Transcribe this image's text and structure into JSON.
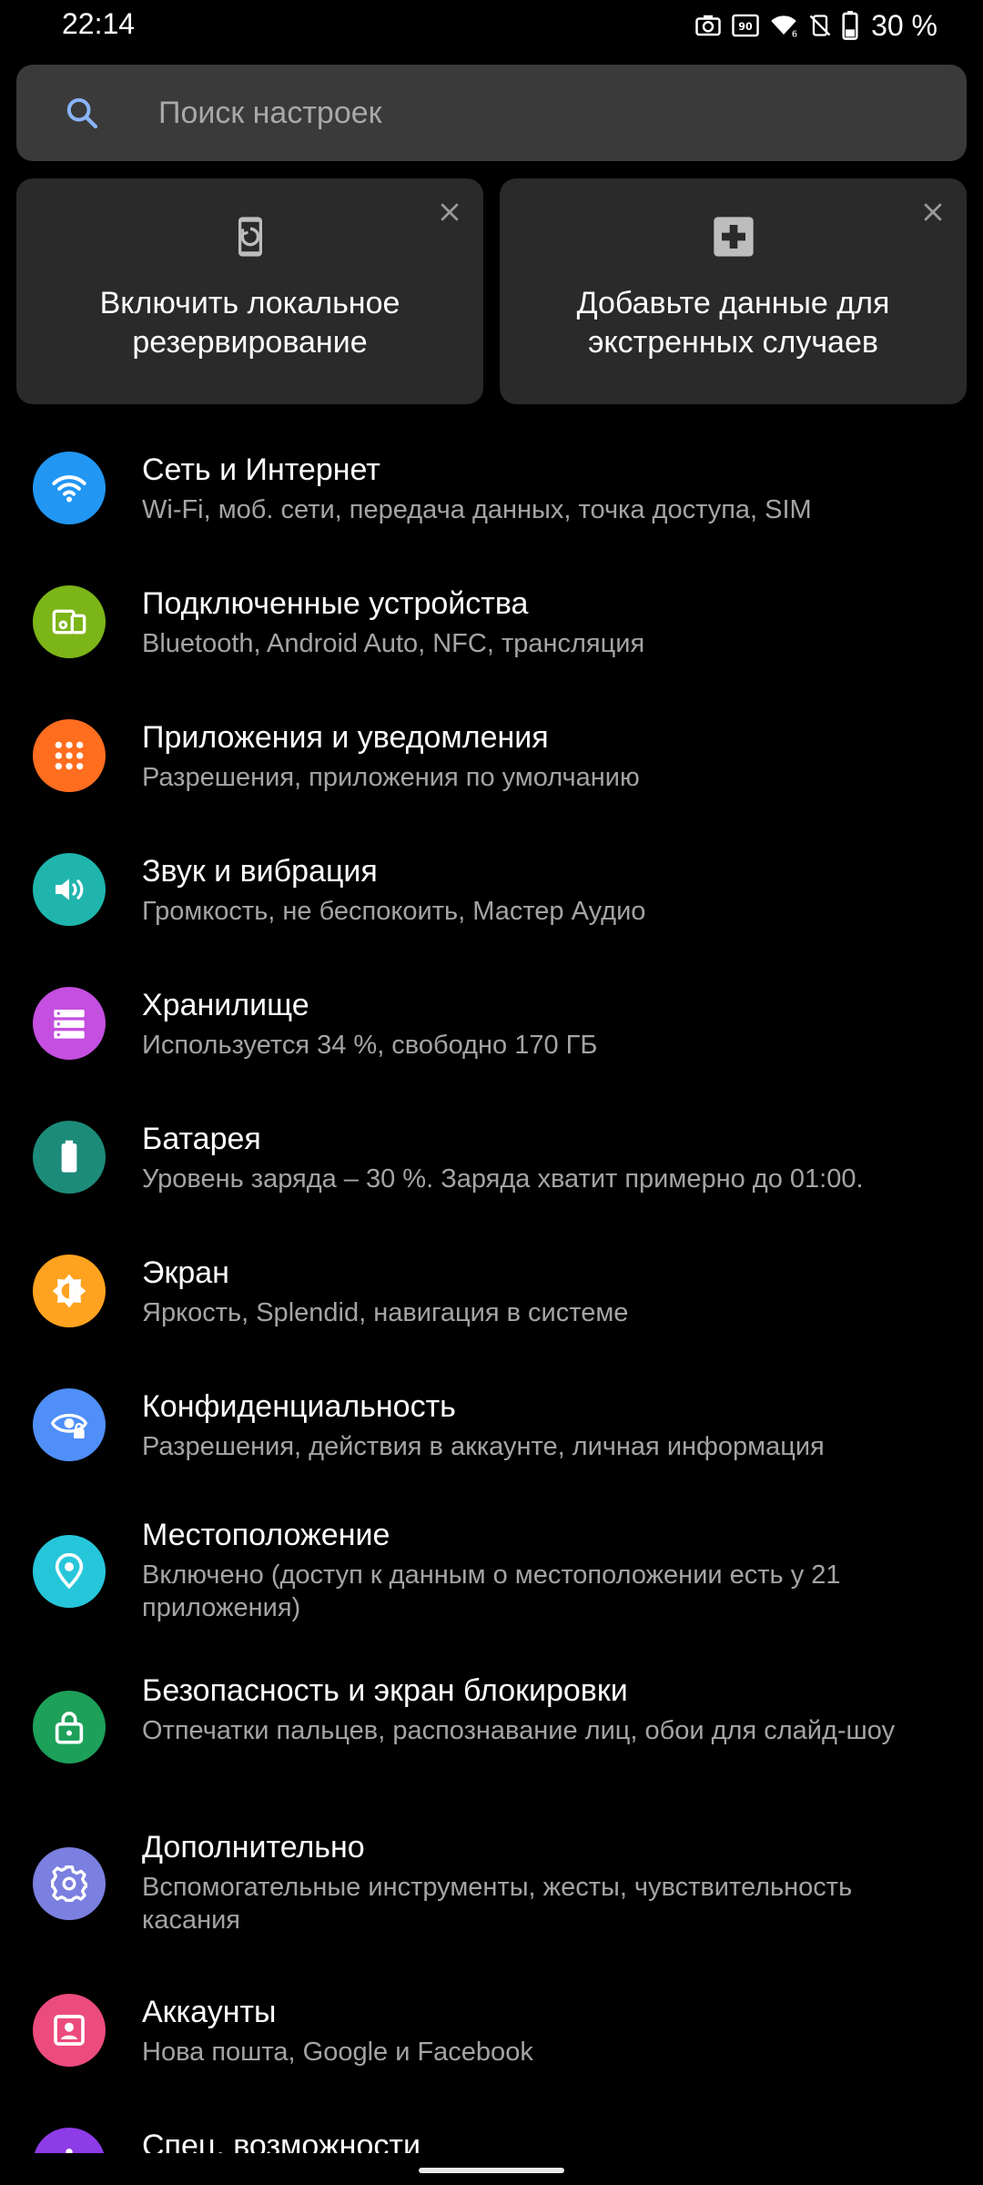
{
  "status_bar": {
    "time": "22:14",
    "battery": "30 %",
    "icons": [
      "camera-icon",
      "refresh-rate-icon",
      "wifi-icon",
      "vibrate-off-icon",
      "battery-icon"
    ]
  },
  "search": {
    "placeholder": "Поиск настроек",
    "value": ""
  },
  "cards": [
    {
      "text": "Включить локальное резервирование",
      "icon": "backup-phone-icon"
    },
    {
      "text": "Добавьте данные для экстренных случаев",
      "icon": "medical-cross-icon"
    }
  ],
  "settings": [
    {
      "title": "Сеть и Интернет",
      "subtitle": "Wi-Fi, моб. сети, передача данных, точка доступа, SIM",
      "color": "#2196f3",
      "icon": "wifi-icon"
    },
    {
      "title": "Подключенные устройства",
      "subtitle": "Bluetooth, Android Auto, NFC, трансляция",
      "color": "#7cb518",
      "icon": "devices-icon"
    },
    {
      "title": "Приложения и уведомления",
      "subtitle": "Разрешения, приложения по умолчанию",
      "color": "#ff6d1f",
      "icon": "apps-grid-icon"
    },
    {
      "title": "Звук и вибрация",
      "subtitle": "Громкость, не беспокоить, Мастер Аудио",
      "color": "#1fb5ad",
      "icon": "speaker-icon"
    },
    {
      "title": "Хранилище",
      "subtitle": "Используется 34 %, свободно 170 ГБ",
      "color": "#c44fe0",
      "icon": "storage-icon"
    },
    {
      "title": "Батарея",
      "subtitle": "Уровень заряда – 30 %. Заряда хватит примерно до 01:00.",
      "color": "#1d8b7a",
      "icon": "battery-icon"
    },
    {
      "title": "Экран",
      "subtitle": "Яркость, Splendid, навигация в системе",
      "color": "#ffa21f",
      "icon": "brightness-icon"
    },
    {
      "title": "Конфиденциальность",
      "subtitle": "Разрешения, действия в аккаунте, личная информация",
      "color": "#4f8ff7",
      "icon": "eye-lock-icon"
    },
    {
      "title": "Местоположение",
      "subtitle": "Включено (доступ к данным о местоположении есть у 21 приложения)",
      "color": "#26c6da",
      "icon": "location-pin-icon"
    },
    {
      "title": "Безопасность и экран блокировки",
      "subtitle": "Отпечатки пальцев, распознавание лиц, обои для слайд-шоу",
      "color": "#1da05a",
      "icon": "lock-icon"
    },
    {
      "title": "Дополнительно",
      "subtitle": "Вспомогательные инструменты, жесты, чувствительность касания",
      "color": "#7b7fe0",
      "icon": "gear-icon"
    },
    {
      "title": "Аккаунты",
      "subtitle": "Нова пошта, Google и Facebook",
      "color": "#ec4b7e",
      "icon": "account-icon"
    },
    {
      "title": "Спец. возможности",
      "subtitle": "",
      "color": "#8e3be8",
      "icon": "accessibility-icon"
    }
  ]
}
